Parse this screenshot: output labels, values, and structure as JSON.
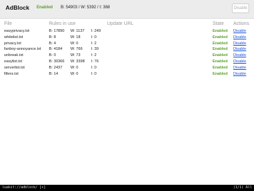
{
  "header": {
    "title": "AdBlock",
    "status": "Enabled",
    "totals": "B: 54903 / W: 5392 / I: 368",
    "disable_label": "Disable"
  },
  "table": {
    "columns": {
      "file": "File",
      "rules": "Rules in use",
      "url": "Update URL",
      "state": "State",
      "actions": "Actions"
    },
    "rows": [
      {
        "file": "easyprivacy.txt",
        "b": "B: 17890",
        "w": "W: 1137",
        "i": "I: 249",
        "url": "",
        "state": "Enabled",
        "action": "Disable"
      },
      {
        "file": "whitelist.txt",
        "b": "B: 8",
        "w": "W: 18",
        "i": "I: 0",
        "url": "",
        "state": "Enabled",
        "action": "Disable"
      },
      {
        "file": "privacy.txt",
        "b": "B: 4",
        "w": "W: 0",
        "i": "I: 2",
        "url": "",
        "state": "Enabled",
        "action": "Disable"
      },
      {
        "file": "fanboy-annoyance.txt",
        "b": "B: 4184",
        "w": "W: 766",
        "i": "I: 39",
        "url": "",
        "state": "Enabled",
        "action": "Disable"
      },
      {
        "file": "unbreak.txt",
        "b": "B: 0",
        "w": "W: 73",
        "i": "I: 2",
        "url": "",
        "state": "Enabled",
        "action": "Disable"
      },
      {
        "file": "easylist.txt",
        "b": "B: 30366",
        "w": "W: 3398",
        "i": "I: 76",
        "url": "",
        "state": "Enabled",
        "action": "Disable"
      },
      {
        "file": "serverlist.txt",
        "b": "B: 2437",
        "w": "W: 0",
        "i": "I: 0",
        "url": "",
        "state": "Enabled",
        "action": "Disable"
      },
      {
        "file": "filters.txt",
        "b": "B: 14",
        "w": "W: 0",
        "i": "I: 0",
        "url": "",
        "state": "Enabled",
        "action": "Disable"
      }
    ]
  },
  "statusbar": {
    "url": "luakit://adblock/ [+]",
    "position": "(1/1) All"
  },
  "colors": {
    "enabled": "#5aa02c",
    "link": "#1a4fd6",
    "header_bg": "#ececec"
  }
}
